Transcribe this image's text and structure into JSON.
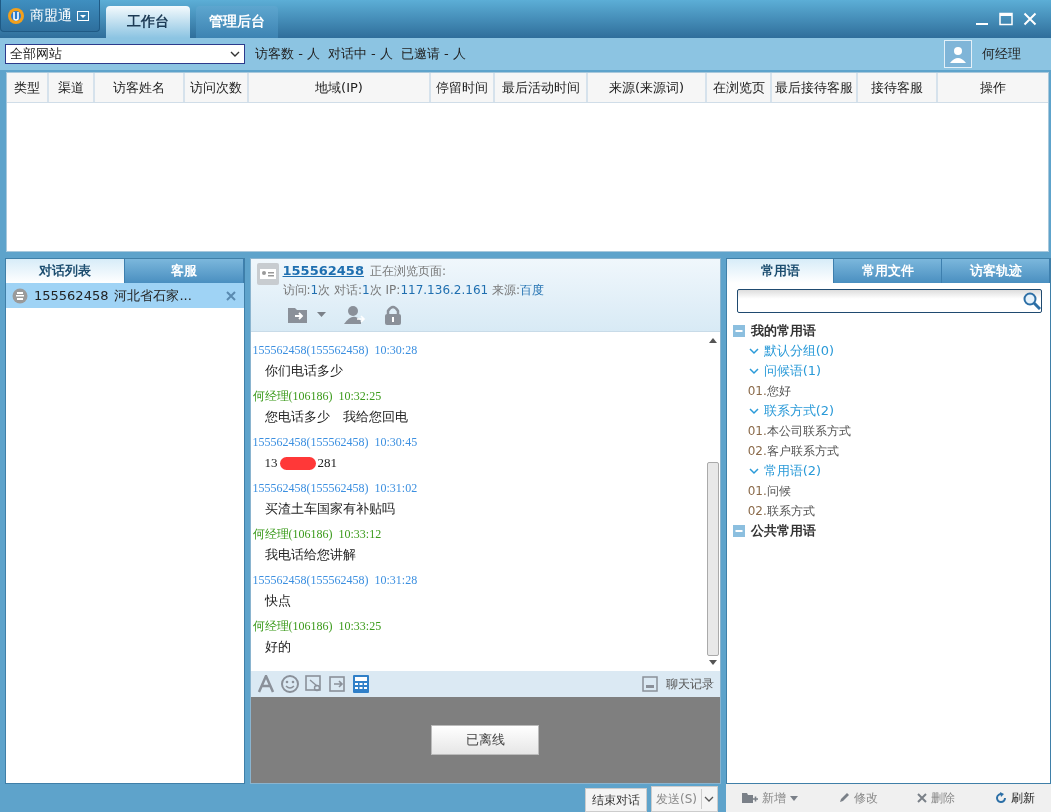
{
  "app": {
    "name": "商盟通"
  },
  "tabs": [
    {
      "label": "工作台",
      "selected": true
    },
    {
      "label": "管理后台",
      "selected": false
    }
  ],
  "site_select": {
    "value": "全部网站"
  },
  "stats": [
    "访客数 - 人",
    "对话中 - 人",
    "已邀请 - 人"
  ],
  "user": {
    "name": "何经理"
  },
  "table": {
    "columns": [
      "类型",
      "渠道",
      "访客姓名",
      "访问次数",
      "地域(IP)",
      "停留时间",
      "最后活动时间",
      "来源(来源词)",
      "在浏览页",
      "最后接待客服",
      "接待客服",
      "操作"
    ]
  },
  "left_tabs": [
    {
      "label": "对话列表",
      "selected": true
    },
    {
      "label": "客服",
      "selected": false
    }
  ],
  "conversations": [
    {
      "name": "155562458",
      "location": "河北省石家...",
      "selected": true
    }
  ],
  "chat": {
    "visitor": "155562458",
    "status": "正在浏览页面:",
    "visit_stats": [
      {
        "label": "访问:",
        "value": "1",
        "unit": "次"
      },
      {
        "label": "对话:",
        "value": "1",
        "unit": "次"
      },
      {
        "label": "IP:",
        "value": "117.136.2.161"
      },
      {
        "label": "来源:",
        "value": "百度"
      }
    ],
    "messages": [
      {
        "kind": "visitor",
        "sender": "155562458(155562458)",
        "time": "10:30:28",
        "text": "你们电话多少"
      },
      {
        "kind": "agent",
        "sender": "何经理(106186)",
        "time": "10:32:25",
        "text": "您电话多少　我给您回电"
      },
      {
        "kind": "visitor",
        "sender": "155562458(155562458)",
        "time": "10:30:45",
        "text": "13",
        "text_after": "281",
        "redacted": true
      },
      {
        "kind": "visitor",
        "sender": "155562458(155562458)",
        "time": "10:31:02",
        "text": "买渣土车国家有补贴吗"
      },
      {
        "kind": "agent",
        "sender": "何经理(106186)",
        "time": "10:33:12",
        "text": "我电话给您讲解"
      },
      {
        "kind": "visitor",
        "sender": "155562458(155562458)",
        "time": "10:31:28",
        "text": "快点"
      },
      {
        "kind": "agent",
        "sender": "何经理(106186)",
        "time": "10:33:25",
        "text": "好的"
      }
    ],
    "history_label": "聊天记录",
    "offline_button": "已离线",
    "end_button": "结束对话",
    "send_button": "发送(S)"
  },
  "right_tabs": [
    {
      "label": "常用语",
      "selected": true
    },
    {
      "label": "常用文件",
      "selected": false
    },
    {
      "label": "访客轨迹",
      "selected": false
    }
  ],
  "phrase_tree": [
    {
      "label": "我的常用语",
      "expanded": true,
      "children": [
        {
          "label": "默认分组(0)",
          "expanded": true
        },
        {
          "label": "问候语(1)",
          "expanded": true,
          "children": [
            {
              "number": "01.",
              "label": "您好"
            }
          ]
        },
        {
          "label": "联系方式(2)",
          "expanded": true,
          "children": [
            {
              "number": "01.",
              "label": "本公司联系方式"
            },
            {
              "number": "02.",
              "label": "客户联系方式"
            }
          ]
        },
        {
          "label": "常用语(2)",
          "expanded": true,
          "children": [
            {
              "number": "01.",
              "label": "问候"
            },
            {
              "number": "02.",
              "label": "联系方式"
            }
          ]
        }
      ]
    },
    {
      "label": "公共常用语",
      "expanded": true
    }
  ],
  "phrase_actions": [
    "新增",
    "修改",
    "删除",
    "刷新"
  ]
}
